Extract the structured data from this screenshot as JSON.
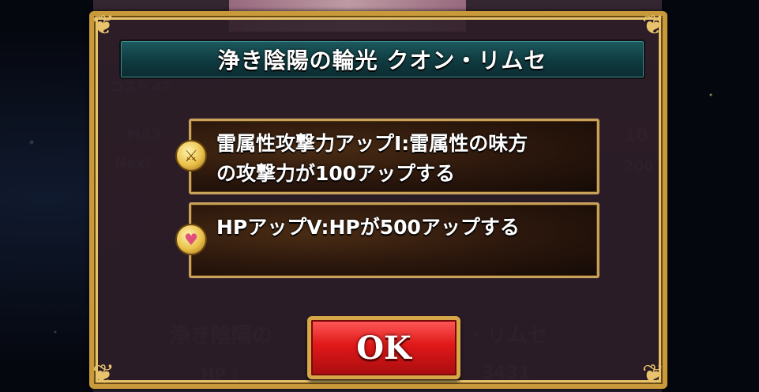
{
  "dialog": {
    "title": "浄き陰陽の輪光 クオン・リムセ",
    "skills": [
      {
        "icon": "attack-up-icon",
        "text": "雷属性攻撃力アップI:雷属性の味方\nの攻撃力が100アップする"
      },
      {
        "icon": "heart-up-icon",
        "text": "HPアップV:HPが500アップする"
      }
    ],
    "ok_label": "OK"
  },
  "background": {
    "cost_label": "コスト 47",
    "max_label": "MAX",
    "next_label": "Next",
    "level_value": "10",
    "exp_value": "200",
    "name_ghost": "浄き陰陽の",
    "name_ghost_tail": "・リムセ",
    "hp_label": "HP :",
    "hp_value": "3431"
  },
  "colors": {
    "frame_gold": "#c99a3a",
    "title_teal": "#0f3b40",
    "ok_red": "#e01818"
  }
}
